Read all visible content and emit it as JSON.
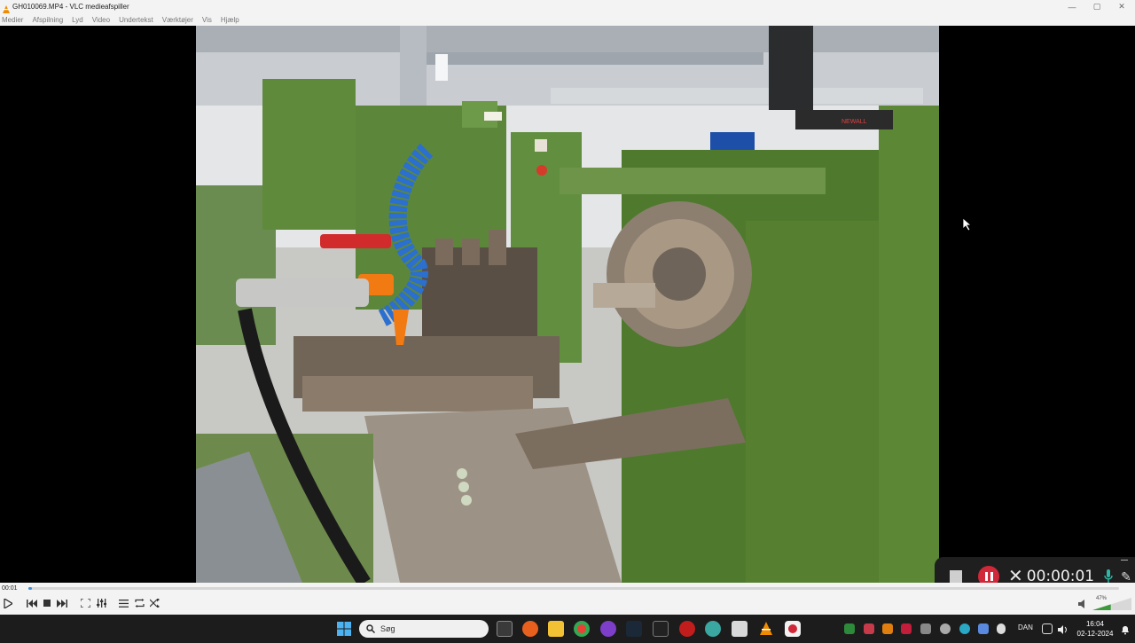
{
  "window": {
    "title": "GH010069.MP4 - VLC medieafspiller",
    "minimize": "—",
    "maximize": "▢",
    "close": "✕"
  },
  "menu": {
    "items": [
      "Medier",
      "Afspilning",
      "Lyd",
      "Video",
      "Undertekst",
      "Værktøjer",
      "Vis",
      "Hjælp"
    ]
  },
  "video": {
    "machine_brand": "NEWALL"
  },
  "player": {
    "elapsed": "00:01",
    "progress": 0.003
  },
  "recorder": {
    "elapsed": "00:00:01"
  },
  "taskbar": {
    "search_placeholder": "Søg",
    "language": "DAN",
    "battery": "47%",
    "time": "16:04",
    "date": "02-12-2024"
  },
  "colors": {
    "accent": "#3b8fde",
    "record": "#d02838",
    "machine_green": "#5f8a3c"
  }
}
